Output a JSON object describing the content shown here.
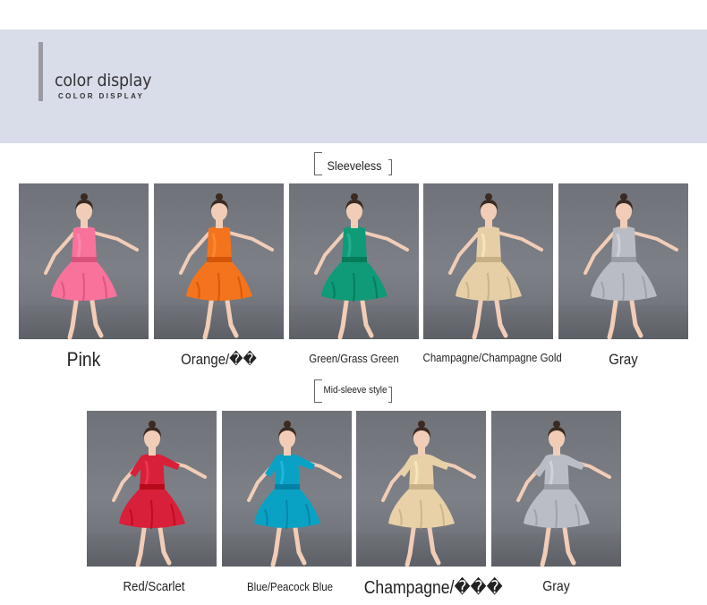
{
  "header": {
    "title": "color display",
    "subtitle": "COLOR DISPLAY"
  },
  "sections": [
    {
      "label": "Sleeveless",
      "items": [
        {
          "caption": "Pink",
          "color": "#f8729b"
        },
        {
          "caption": "Orange/��",
          "color": "#f3741c"
        },
        {
          "caption": "Green/Grass Green",
          "color": "#0f9a78"
        },
        {
          "caption": "Champagne/Champagne Gold",
          "color": "#e6cfa6"
        },
        {
          "caption": "Gray",
          "color": "#b9bcc4"
        }
      ]
    },
    {
      "label": "Mid-sleeve style",
      "items": [
        {
          "caption": "Red/Scarlet",
          "color": "#d8203a"
        },
        {
          "caption": "Blue/Peacock Blue",
          "color": "#0aa2c4"
        },
        {
          "caption": "Champagne/���",
          "color": "#e8d0a7"
        },
        {
          "caption": "Gray",
          "color": "#babdc6"
        }
      ]
    }
  ]
}
